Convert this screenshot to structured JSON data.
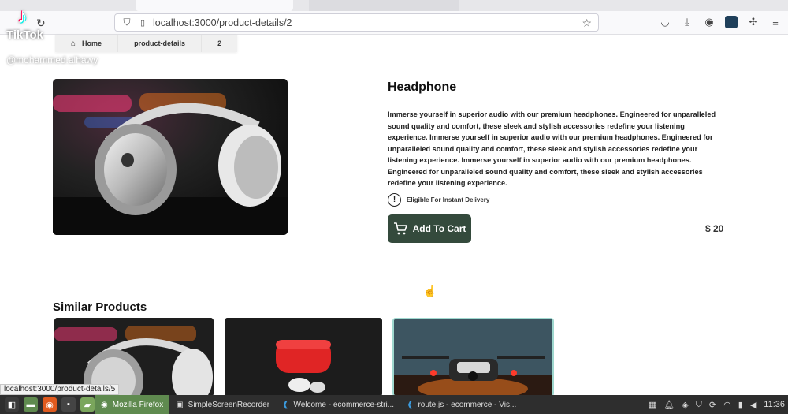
{
  "browser": {
    "url": "localhost:3000/product-details/2",
    "reload_icon": "↻",
    "star_icon": "☆"
  },
  "overlay": {
    "tiktok_logo": "♪",
    "tiktok_brand": "TikTok",
    "username": "@mohammed.alhawy"
  },
  "breadcrumb": {
    "home": "Home",
    "section": "product-details",
    "id": "2"
  },
  "product": {
    "title": "Headphone",
    "description": "Immerse yourself in superior audio with our premium headphones. Engineered for unparalleled sound quality and comfort, these sleek and stylish accessories redefine your listening experience. Immerse yourself in superior audio with our premium headphones. Engineered for unparalleled sound quality and comfort, these sleek and stylish accessories redefine your listening experience. Immerse yourself in superior audio with our premium headphones. Engineered for unparalleled sound quality and comfort, these sleek and stylish accessories redefine your listening experience.",
    "delivery_label": "Eligible For Instant Delivery",
    "add_to_cart": "Add To Cart",
    "price": "$ 20"
  },
  "similar": {
    "title": "Similar Products"
  },
  "status_bar": {
    "url": "localhost:3000/product-details/5"
  },
  "taskbar": {
    "tasks": [
      "Mozilla Firefox",
      "SimpleScreenRecorder",
      "Welcome - ecommerce-stri...",
      "route.js - ecommerce - Vis..."
    ],
    "clock": "11:36"
  },
  "colors": {
    "button_bg": "#344a3c",
    "taskbar_bg": "#2e2e2e",
    "active_task": "#5f8a4f"
  }
}
